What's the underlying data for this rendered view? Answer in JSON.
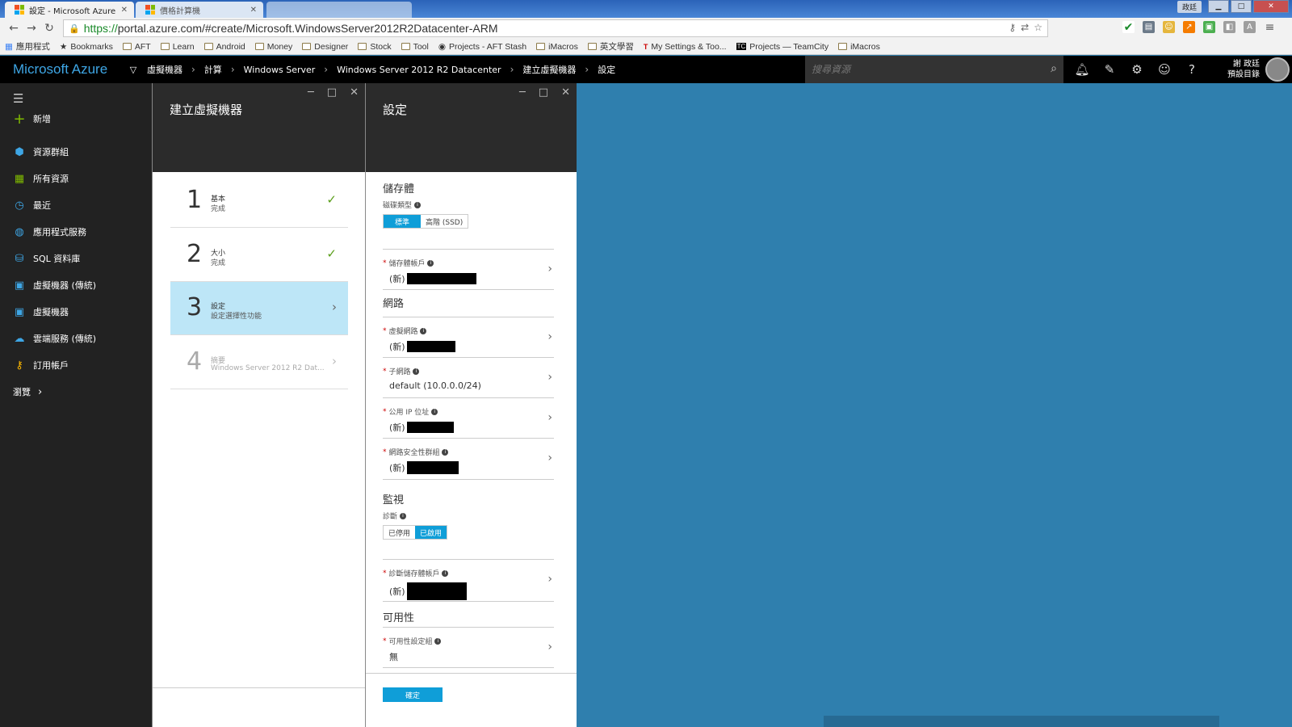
{
  "browser": {
    "tabs": [
      {
        "title": "設定 - Microsoft Azure",
        "active": true
      },
      {
        "title": "價格計算機",
        "active": false
      }
    ],
    "user_badge": "政廷",
    "url_scheme": "https://",
    "url_rest": "portal.azure.com/#create/Microsoft.WindowsServer2012R2Datacenter-ARM",
    "bookmarks": [
      "應用程式",
      "Bookmarks",
      "AFT",
      "Learn",
      "Android",
      "Money",
      "Designer",
      "Stock",
      "Tool",
      "Projects - AFT Stash",
      "iMacros",
      "英文學習",
      "My Settings & Too...",
      "Projects — TeamCity",
      "iMacros"
    ]
  },
  "azure": {
    "brand": "Microsoft Azure",
    "breadcrumbs": [
      "虛擬機器",
      "計算",
      "Windows Server",
      "Windows Server 2012 R2 Datacenter",
      "建立虛擬機器",
      "設定"
    ],
    "search_placeholder": "搜尋資源",
    "user_name": "謝 政廷",
    "user_directory": "預設目錄"
  },
  "leftnav": {
    "new_label": "新增",
    "items": [
      "資源群組",
      "所有資源",
      "最近",
      "應用程式服務",
      "SQL 資料庫",
      "虛擬機器 (傳統)",
      "虛擬機器",
      "雲端服務 (傳統)",
      "訂用帳戶"
    ],
    "browse_label": "瀏覽"
  },
  "blade_create": {
    "title": "建立虛擬機器",
    "steps": [
      {
        "num": "1",
        "title": "基本",
        "sub": "完成",
        "state": "done"
      },
      {
        "num": "2",
        "title": "大小",
        "sub": "完成",
        "state": "done"
      },
      {
        "num": "3",
        "title": "設定",
        "sub": "設定選擇性功能",
        "state": "active"
      },
      {
        "num": "4",
        "title": "摘要",
        "sub": "Windows Server 2012 R2 Dat...",
        "state": "disabled"
      }
    ]
  },
  "blade_settings": {
    "title": "設定",
    "storage": {
      "section": "儲存體",
      "disk_type_label": "磁碟類型",
      "disk_standard": "標準",
      "disk_premium": "高階 (SSD)",
      "account_label": "儲存體帳戶",
      "account_value_prefix": "(新)"
    },
    "network": {
      "section": "網路",
      "vnet_label": "虛擬網路",
      "vnet_value_prefix": "(新)",
      "subnet_label": "子網路",
      "subnet_value": "default (10.0.0.0/24)",
      "public_ip_label": "公用 IP 位址",
      "public_ip_value_prefix": "(新)",
      "nsg_label": "網路安全性群組",
      "nsg_value_prefix": "(新)"
    },
    "monitoring": {
      "section": "監視",
      "diag_label": "診斷",
      "diag_disabled": "已停用",
      "diag_enabled": "已啟用",
      "diag_storage_label": "診斷儲存體帳戶",
      "diag_storage_value_prefix": "(新)"
    },
    "availability": {
      "section": "可用性",
      "set_label": "可用性設定組",
      "set_value": "無"
    },
    "ok_label": "確定"
  },
  "colors": {
    "accent": "#0f9ed8",
    "portal_bg": "#2f7fae",
    "active_step": "#bde6f7",
    "check": "#5a9e1a"
  }
}
